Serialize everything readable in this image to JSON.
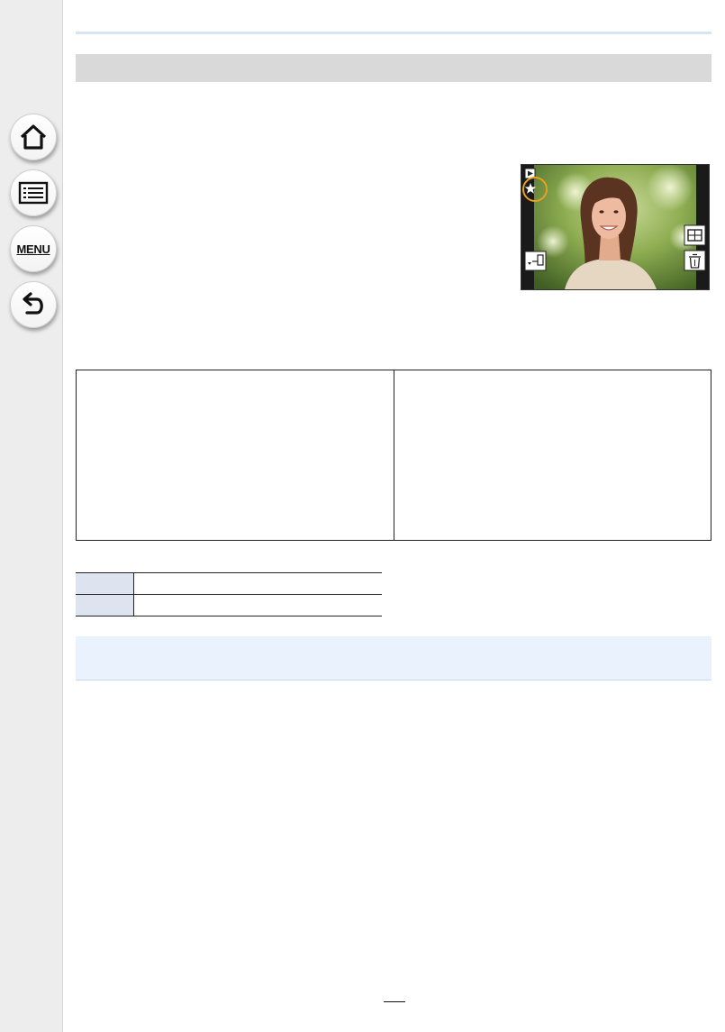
{
  "sidebar": {
    "home_icon": "home-icon",
    "contents_icon": "list-icon",
    "menu_label": "MENU",
    "back_icon": "back-arrow-icon"
  },
  "section": {
    "title": ""
  },
  "photo": {
    "overlay_icons": [
      "playback-icon",
      "favorite-star-icon",
      "send-to-smartphone-icon",
      "multi-playback-icon",
      "delete-icon"
    ],
    "highlight_color": "#e8a020"
  },
  "info_table": {
    "columns": [
      "",
      ""
    ]
  },
  "small_table": {
    "rows": [
      [
        "",
        ""
      ],
      [
        "",
        ""
      ]
    ]
  },
  "note": {
    "text": ""
  },
  "page": {
    "number": ""
  },
  "colors": {
    "sidebar_bg": "#ededed",
    "header_rule": "#d6e4f3",
    "section_bar": "#d9d9d9",
    "note_bg": "#eaf2fd",
    "table_key_bg": "#dde3ef"
  }
}
